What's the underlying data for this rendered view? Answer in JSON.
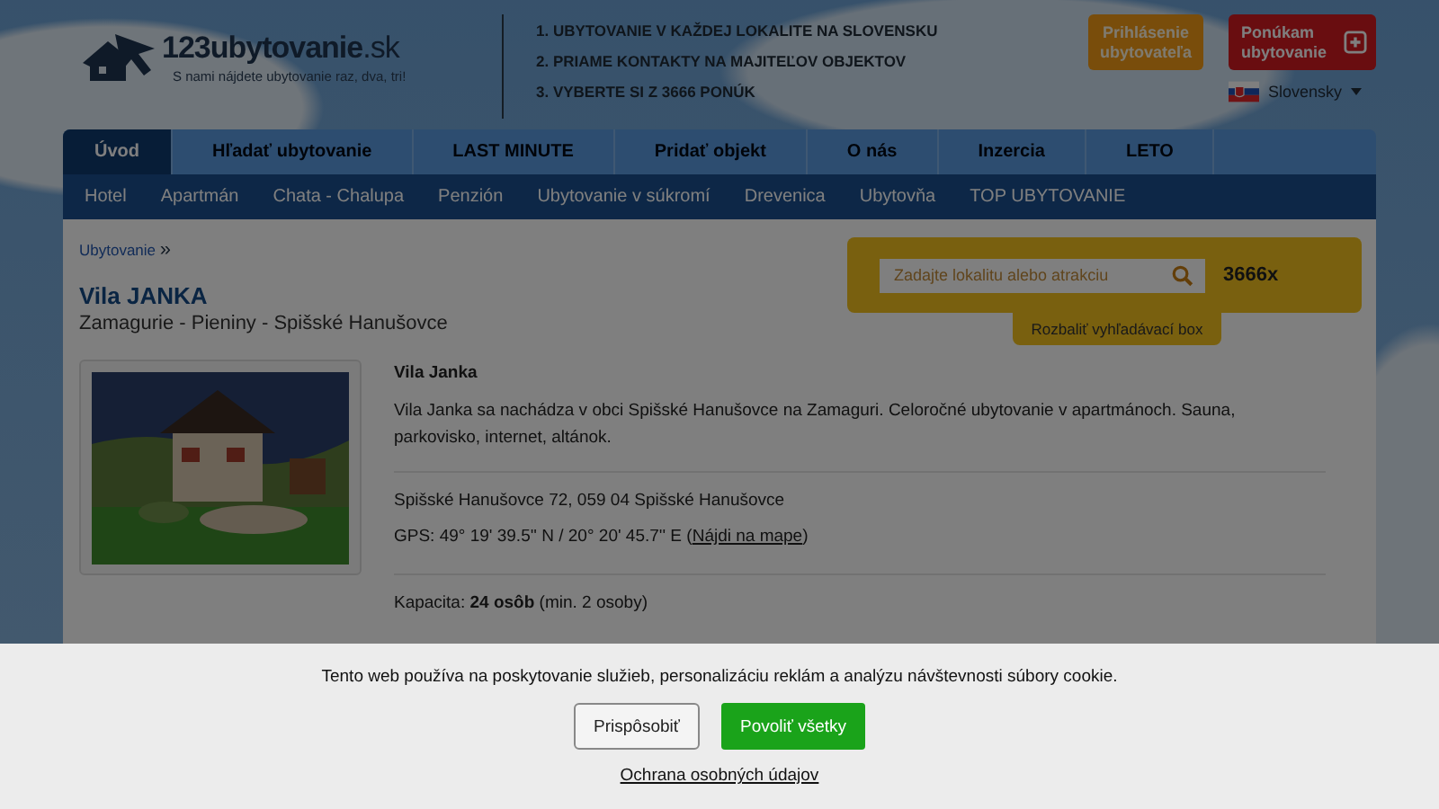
{
  "header": {
    "logo_text": "123ubytovanie",
    "logo_suffix": ".sk",
    "tagline": "S nami nájdete ubytovanie raz, dva, tri!",
    "highlights": [
      "1. UBYTOVANIE V KAŽDEJ LOKALITE NA SLOVENSKU",
      "2. PRIAME KONTAKTY NA MAJITEĽOV OBJEKTOV",
      "3. VYBERTE SI Z 3666 PONÚK"
    ],
    "login_button": "Prihlásenie ubytovateľa",
    "offer_button": "Ponúkam ubytovanie",
    "language": "Slovensky"
  },
  "main_nav": [
    {
      "label": "Úvod",
      "selected": true
    },
    {
      "label": "Hľadať ubytovanie",
      "selected": false
    },
    {
      "label": "LAST MINUTE",
      "selected": false
    },
    {
      "label": "Pridať objekt",
      "selected": false
    },
    {
      "label": "O nás",
      "selected": false
    },
    {
      "label": "Inzercia",
      "selected": false
    },
    {
      "label": "LETO",
      "selected": false
    }
  ],
  "sub_nav": [
    "Hotel",
    "Apartmán",
    "Chata - Chalupa",
    "Penzión",
    "Ubytovanie v súkromí",
    "Drevenica",
    "Ubytovňa",
    "TOP UBYTOVANIE"
  ],
  "breadcrumb": {
    "link": "Ubytovanie",
    "separator": "»"
  },
  "search": {
    "placeholder": "Zadajte lokalitu alebo atrakciu",
    "count": "3666x",
    "expand": "Rozbaliť vyhľadávací box"
  },
  "listing": {
    "title": "Vila JANKA",
    "region": "Zamagurie - Pieniny - Spišské Hanušovce",
    "name": "Vila Janka",
    "description": "Vila Janka sa nachádza v obci Spišské Hanušovce na Zamaguri. Celoročné ubytovanie v apartmánoch. Sauna, parkovisko, internet, altánok.",
    "address": "Spišské Hanušovce 72, 059 04 Spišské Hanušovce",
    "gps": "GPS: 49° 19' 39.5'' N / 20° 20' 45.7'' E (",
    "map_link": "Nájdi na mape",
    "gps_end": ")",
    "capacity": "Kapacita: **24 osôb** (min. 2 osoby)"
  },
  "cookie_banner": {
    "text": "Tento web používa na poskytovanie služieb, personalizáciu reklám a analýzu návštevnosti súbory cookie.",
    "customize": "Prispôsobiť",
    "allow_all": "Povoliť všetky",
    "privacy": "Ochrana osobných údajov"
  }
}
